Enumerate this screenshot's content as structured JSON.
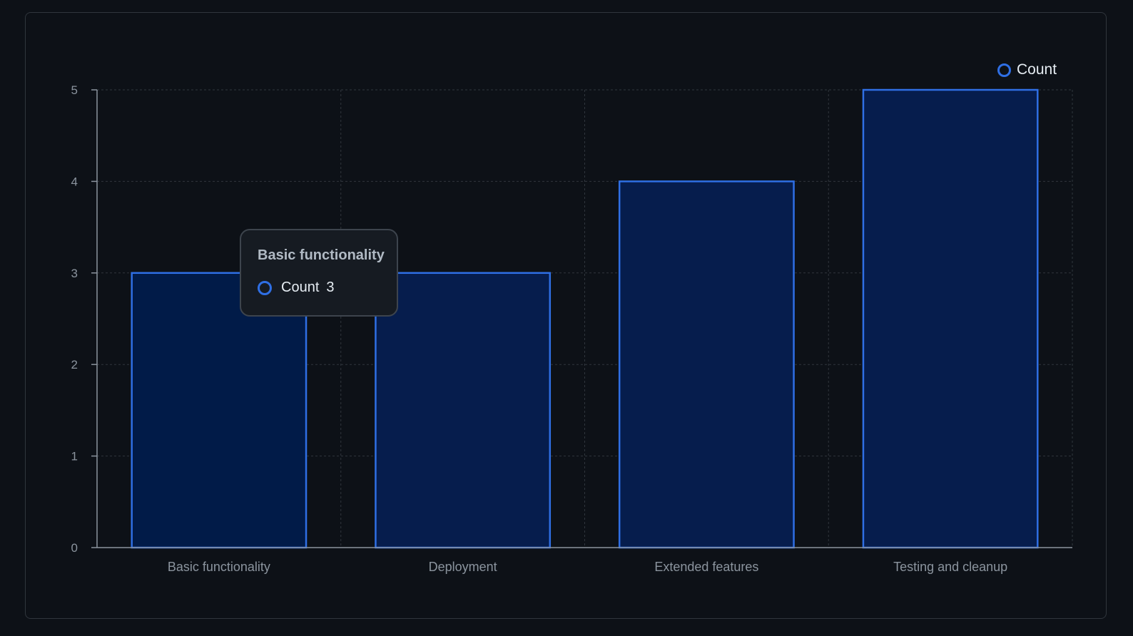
{
  "chart_data": {
    "type": "bar",
    "categories": [
      "Basic functionality",
      "Deployment",
      "Extended features",
      "Testing and cleanup"
    ],
    "series": [
      {
        "name": "Count",
        "values": [
          3,
          3,
          4,
          5
        ]
      }
    ],
    "ylim": [
      0,
      5
    ],
    "yticks": [
      0,
      1,
      2,
      3,
      4,
      5
    ],
    "grid": true,
    "legend": "top-right"
  },
  "tooltip": {
    "title": "Basic functionality",
    "series_name": "Count",
    "value": "3"
  },
  "legend": {
    "label": "Count"
  },
  "colors": {
    "background": "#0d1117",
    "bar_stroke": "#2f6fe4",
    "bar_fill": "#061d4d",
    "bar_fill_active": "#011b48",
    "grid": "#30363d",
    "axis": "#8b949e",
    "tick_text": "#8b949e"
  }
}
